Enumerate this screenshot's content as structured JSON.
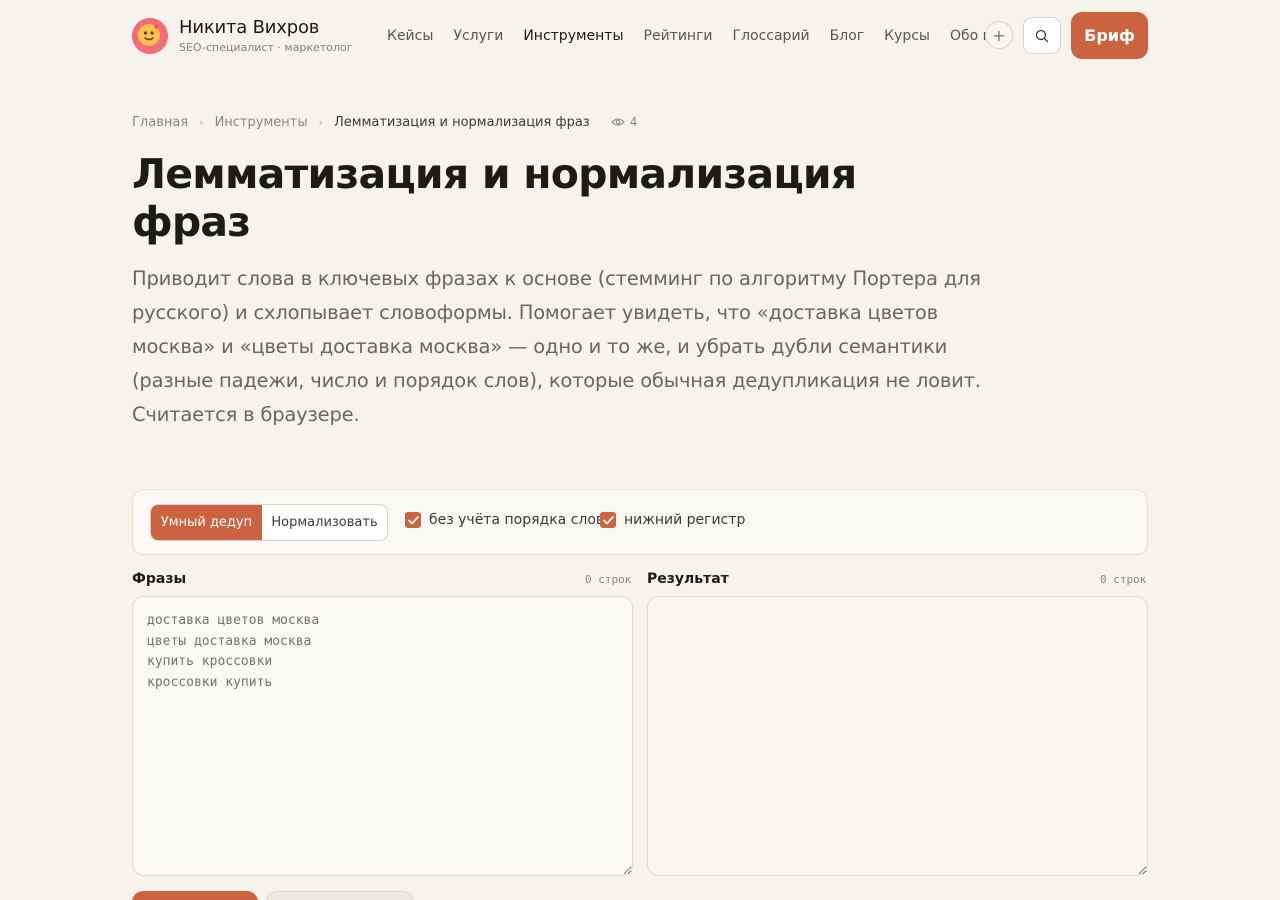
{
  "brand": {
    "name": "Никита Вихров",
    "subtitle": "SEO-специалист · маркетолог",
    "avatar_icon": "emoji-avatar-icon"
  },
  "nav": {
    "items": [
      "Кейсы",
      "Услуги",
      "Инструменты",
      "Рейтинги",
      "Глоссарий",
      "Блог",
      "Курсы",
      "Обо мне"
    ],
    "active": "Инструменты",
    "plus_label": "+",
    "brief_label": "Бриф"
  },
  "breadcrumb": {
    "items": [
      "Главная",
      "Инструменты",
      "Лемматизация и нормализация фраз"
    ],
    "views": "4"
  },
  "page": {
    "title": "Лемматизация и нормализация фраз",
    "lead": "Приводит слова в ключевых фразах к основе (стемминг по алгоритму Портера для русского) и схлопывает словоформы. Помогает увидеть, что «доставка цветов москва» и «цветы доставка москва» — одно и то же, и убрать дубли семантики (разные падежи, число и порядок слов), которые обычная дедупликация не ловит. Считается в браузере."
  },
  "toolbar": {
    "modes": [
      "Умный дедуп",
      "Нормализовать"
    ],
    "active_mode": "Умный дедуп",
    "options": [
      {
        "label": "без учёта порядка слов",
        "checked": true
      },
      {
        "label": "нижний регистр",
        "checked": true
      }
    ]
  },
  "input_panel": {
    "label": "Фразы",
    "count": "0 строк",
    "value": "",
    "placeholder": "доставка цветов москва\nцветы доставка москва\nкупить кроссовки\nкроссовки купить"
  },
  "output_panel": {
    "label": "Результат",
    "count": "0 строк",
    "value": ""
  },
  "colors": {
    "accent": "#cc6340",
    "background": "#f5f3ec"
  }
}
